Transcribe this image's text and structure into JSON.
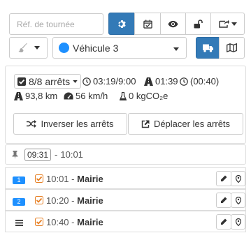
{
  "search": {
    "placeholder": "Réf. de tournée",
    "value": ""
  },
  "toolbar": {
    "buttons": [
      {
        "icon": "gear-icon",
        "active": true
      },
      {
        "icon": "calendar-check-icon",
        "active": false
      },
      {
        "icon": "eye-icon",
        "active": false
      },
      {
        "icon": "unlock-icon",
        "active": false
      },
      {
        "icon": "share-dropdown-icon",
        "active": false
      }
    ]
  },
  "vehicle": {
    "label": "Véhicule 3",
    "color": "#1e90ff"
  },
  "view_toggle": {
    "active": "truck-icon",
    "other": "map-icon"
  },
  "summary": {
    "stops": "8/8 arrêts",
    "time": "03:19/9:00",
    "duration": "01:39",
    "wait": "(00:40)",
    "distance": "93,8 km",
    "speed": "56 km/h",
    "co2": "0 kgCO₂e"
  },
  "actions": {
    "reverse": "Inverser les arrêts",
    "move": "Déplacer les arrêts"
  },
  "departure": {
    "time": "09:31",
    "separator": "-",
    "end": "10:01"
  },
  "stops": [
    {
      "badge": "1",
      "time": "10:01",
      "name": "Mairie"
    },
    {
      "badge": "2",
      "time": "10:20",
      "name": "Mairie"
    },
    {
      "badge": "",
      "time": "10:40",
      "name": "Mairie"
    }
  ],
  "colors": {
    "primary": "#337ab7",
    "checkbox": "#e67e22",
    "badge": "#1e90ff"
  }
}
